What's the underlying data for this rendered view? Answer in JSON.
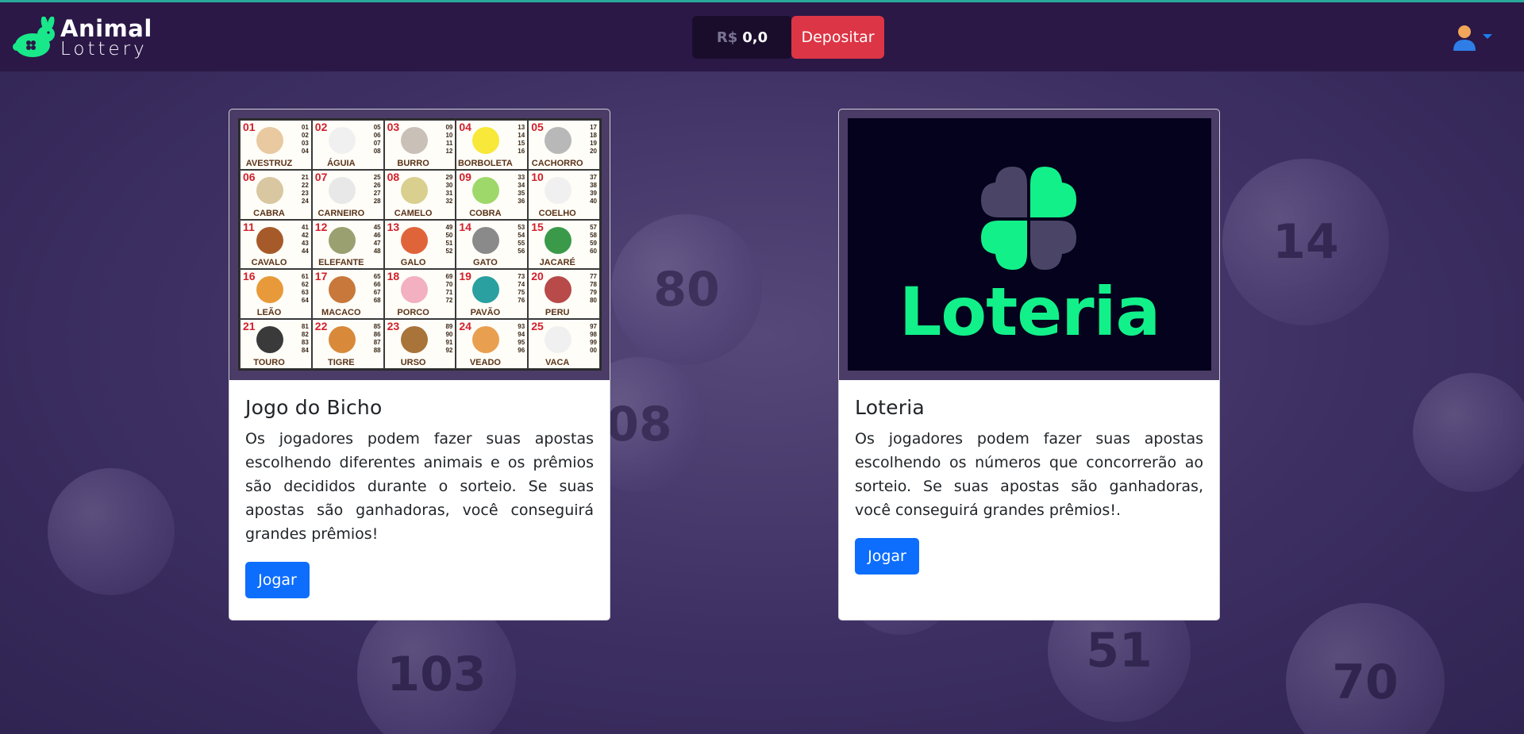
{
  "header": {
    "logo_line1": "Animal",
    "logo_line2": "Lottery",
    "balance_currency": "R$",
    "balance_amount": "0,0",
    "deposit_label": "Depositar",
    "user_icon": "user-avatar-icon"
  },
  "colors": {
    "header_bg": "#2b1847",
    "deposit": "#dc3545",
    "play_button": "#0d6efd",
    "brand_green": "#12f08a"
  },
  "cards": [
    {
      "title": "Jogo do Bicho",
      "text": "Os jogadores podem fazer suas apostas escolhendo diferentes animais e os prêmios são decididos durante o sorteio. Se suas apostas são ganhadoras, você conseguirá grandes prêmios!",
      "button": "Jogar",
      "animals": [
        {
          "no": "01",
          "name": "AVESTRUZ",
          "nums": [
            "01",
            "02",
            "03",
            "04"
          ]
        },
        {
          "no": "02",
          "name": "ÁGUIA",
          "nums": [
            "05",
            "06",
            "07",
            "08"
          ]
        },
        {
          "no": "03",
          "name": "BURRO",
          "nums": [
            "09",
            "10",
            "11",
            "12"
          ]
        },
        {
          "no": "04",
          "name": "BORBOLETA",
          "nums": [
            "13",
            "14",
            "15",
            "16"
          ]
        },
        {
          "no": "05",
          "name": "CACHORRO",
          "nums": [
            "17",
            "18",
            "19",
            "20"
          ]
        },
        {
          "no": "06",
          "name": "CABRA",
          "nums": [
            "21",
            "22",
            "23",
            "24"
          ]
        },
        {
          "no": "07",
          "name": "CARNEIRO",
          "nums": [
            "25",
            "26",
            "27",
            "28"
          ]
        },
        {
          "no": "08",
          "name": "CAMELO",
          "nums": [
            "29",
            "30",
            "31",
            "32"
          ]
        },
        {
          "no": "09",
          "name": "COBRA",
          "nums": [
            "33",
            "34",
            "35",
            "36"
          ]
        },
        {
          "no": "10",
          "name": "COELHO",
          "nums": [
            "37",
            "38",
            "39",
            "40"
          ]
        },
        {
          "no": "11",
          "name": "CAVALO",
          "nums": [
            "41",
            "42",
            "43",
            "44"
          ]
        },
        {
          "no": "12",
          "name": "ELEFANTE",
          "nums": [
            "45",
            "46",
            "47",
            "48"
          ]
        },
        {
          "no": "13",
          "name": "GALO",
          "nums": [
            "49",
            "50",
            "51",
            "52"
          ]
        },
        {
          "no": "14",
          "name": "GATO",
          "nums": [
            "53",
            "54",
            "55",
            "56"
          ]
        },
        {
          "no": "15",
          "name": "JACARÉ",
          "nums": [
            "57",
            "58",
            "59",
            "60"
          ]
        },
        {
          "no": "16",
          "name": "LEÃO",
          "nums": [
            "61",
            "62",
            "63",
            "64"
          ]
        },
        {
          "no": "17",
          "name": "MACACO",
          "nums": [
            "65",
            "66",
            "67",
            "68"
          ]
        },
        {
          "no": "18",
          "name": "PORCO",
          "nums": [
            "69",
            "70",
            "71",
            "72"
          ]
        },
        {
          "no": "19",
          "name": "PAVÃO",
          "nums": [
            "73",
            "74",
            "75",
            "76"
          ]
        },
        {
          "no": "20",
          "name": "PERU",
          "nums": [
            "77",
            "78",
            "79",
            "80"
          ]
        },
        {
          "no": "21",
          "name": "TOURO",
          "nums": [
            "81",
            "82",
            "83",
            "84"
          ]
        },
        {
          "no": "22",
          "name": "TIGRE",
          "nums": [
            "85",
            "86",
            "87",
            "88"
          ]
        },
        {
          "no": "23",
          "name": "URSO",
          "nums": [
            "89",
            "90",
            "91",
            "92"
          ]
        },
        {
          "no": "24",
          "name": "VEADO",
          "nums": [
            "93",
            "94",
            "95",
            "96"
          ]
        },
        {
          "no": "25",
          "name": "VACA",
          "nums": [
            "97",
            "98",
            "99",
            "00"
          ]
        }
      ]
    },
    {
      "title": "Loteria",
      "text": "Os jogadores podem fazer suas apostas escolhendo os números que concorrerão ao sorteio. Se suas apostas são ganhadoras, você conseguirá grandes prêmios!.",
      "button": "Jogar",
      "image_word": "Loteria"
    }
  ],
  "background_balls": [
    "80",
    "08",
    "14",
    "103",
    "51",
    "70"
  ]
}
